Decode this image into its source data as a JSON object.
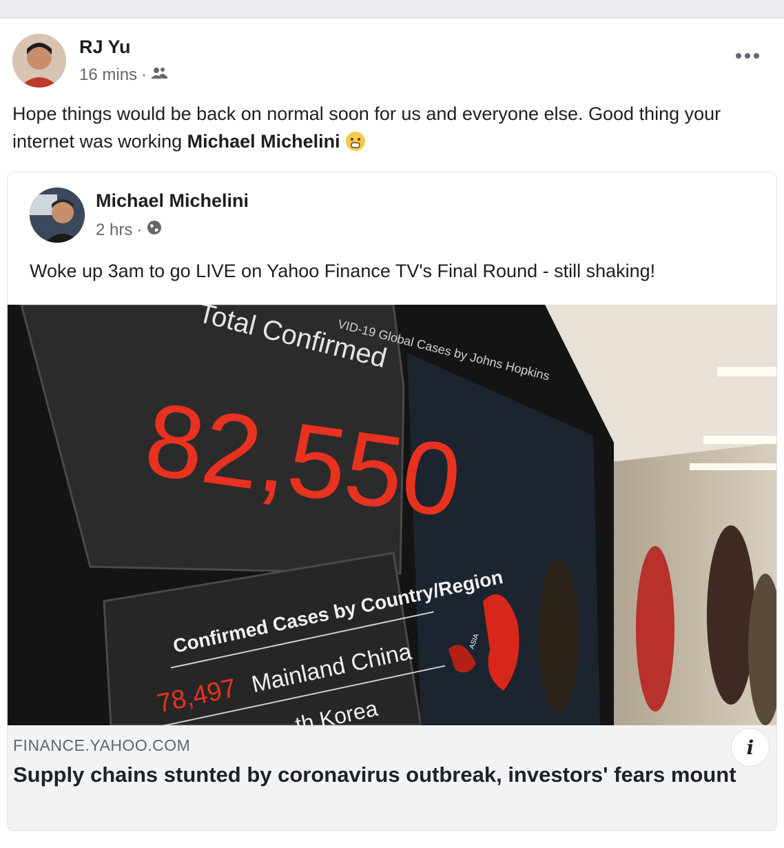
{
  "post": {
    "author": "RJ Yu",
    "time": "16 mins",
    "separator": "·",
    "audience_icon": "friends-icon",
    "text_before": "Hope things would be back on normal soon for us and everyone else. Good thing your internet was working ",
    "mention": "Michael Michelini",
    "emoji": "surprised-emoji"
  },
  "shared": {
    "author": "Michael Michelini",
    "time": "2 hrs",
    "separator": "·",
    "audience_icon": "globe-icon",
    "text": "Woke up 3am to go LIVE on Yahoo Finance TV's Final Round - still shaking!"
  },
  "photo": {
    "header": "VID-19 Global Cases by Johns Hopkins",
    "label": "Total Confirmed",
    "count": "82,550",
    "table_title": "Confirmed Cases by Country/Region",
    "row1_count": "78,497",
    "row1_name": "Mainland China",
    "row2_name": "th Korea",
    "map_label": "ASIA"
  },
  "link": {
    "domain": "FINANCE.YAHOO.COM",
    "headline": "Supply chains stunted by coronavirus outbreak, investors' fears mount",
    "info_label": "i"
  },
  "colors": {
    "accent_red": "#e8321f",
    "meta_gray": "#65676b"
  }
}
